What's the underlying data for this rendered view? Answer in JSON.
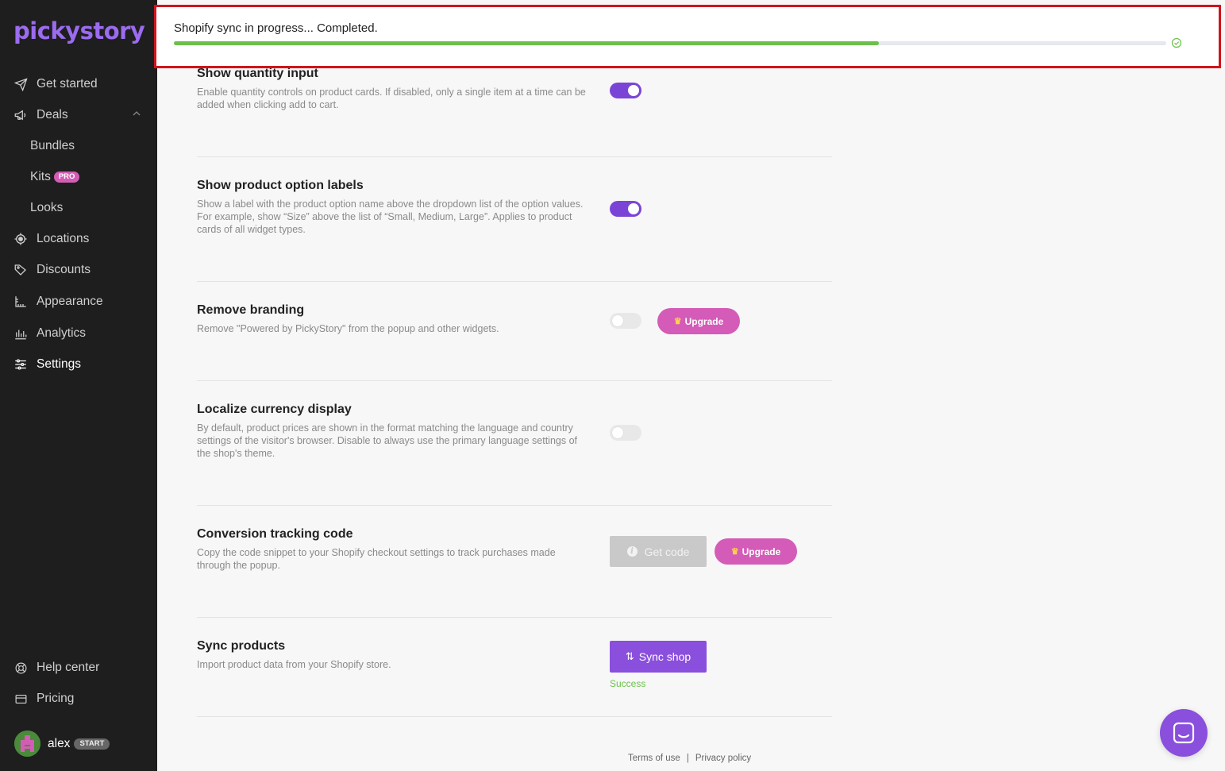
{
  "sidebar": {
    "brand": "pickystory",
    "items": [
      {
        "label": "Get started",
        "icon": "send-icon"
      },
      {
        "label": "Deals",
        "icon": "megaphone-icon"
      },
      {
        "label": "Bundles"
      },
      {
        "label": "Kits",
        "badge": "PRO"
      },
      {
        "label": "Looks"
      },
      {
        "label": "Locations",
        "icon": "target-icon"
      },
      {
        "label": "Discounts",
        "icon": "tag-icon"
      },
      {
        "label": "Appearance",
        "icon": "ruler-icon"
      },
      {
        "label": "Analytics",
        "icon": "bar-chart-icon"
      },
      {
        "label": "Settings",
        "icon": "sliders-icon",
        "active": true
      }
    ],
    "help_label": "Help center",
    "pricing_label": "Pricing",
    "user": {
      "name": "alex",
      "plan_badge": "START"
    }
  },
  "sync_banner": {
    "text": "Shopify sync in progress... Completed.",
    "progress_percent": 71,
    "progress_color": "#6cc04a"
  },
  "settings": {
    "quantity": {
      "title": "Show quantity input",
      "desc": "Enable quantity controls on product cards. If disabled, only a single item at a time can be added when clicking add to cart.",
      "enabled": true
    },
    "option_labels": {
      "title": "Show product option labels",
      "desc": "Show a label with the product option name above the dropdown list of the option values. For example, show “Size” above the list of “Small, Medium, Large”. Applies to product cards of all widget types.",
      "enabled": true
    },
    "branding": {
      "title": "Remove branding",
      "desc": "Remove \"Powered by PickyStory\" from the popup and other widgets.",
      "enabled": false,
      "upgrade_label": "Upgrade"
    },
    "currency": {
      "title": "Localize currency display",
      "desc": "By default, product prices are shown in the format matching the language and country settings of the visitor's browser. Disable to always use the primary language settings of the shop's theme.",
      "enabled": false
    },
    "tracking": {
      "title": "Conversion tracking code",
      "desc": "Copy the code snippet to your Shopify checkout settings to track purchases made through the popup.",
      "get_code_label": "Get code",
      "upgrade_label": "Upgrade"
    },
    "sync": {
      "title": "Sync products",
      "desc": "Import product data from your Shopify store.",
      "button_label": "Sync shop",
      "status": "Success"
    }
  },
  "footer": {
    "terms": "Terms of use",
    "separator": "|",
    "privacy": "Privacy policy"
  },
  "colors": {
    "accent": "#8a4fdc",
    "upgrade": "#d45bb8",
    "banner_border": "#d0141c"
  }
}
